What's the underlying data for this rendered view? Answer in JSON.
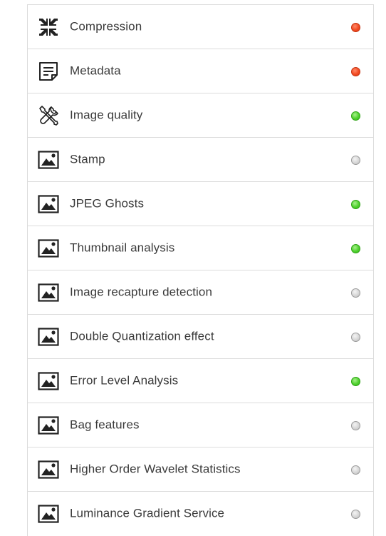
{
  "checks": [
    {
      "label": "Compression",
      "icon": "compress-icon",
      "status": "red",
      "status_color": "#f24a22"
    },
    {
      "label": "Metadata",
      "icon": "document-icon",
      "status": "red",
      "status_color": "#f24a22"
    },
    {
      "label": "Image quality",
      "icon": "tools-icon",
      "status": "green",
      "status_color": "#4fd12e"
    },
    {
      "label": "Stamp",
      "icon": "image-icon",
      "status": "gray",
      "status_color": "#d4d4d4"
    },
    {
      "label": "JPEG Ghosts",
      "icon": "image-icon",
      "status": "green",
      "status_color": "#4fd12e"
    },
    {
      "label": "Thumbnail analysis",
      "icon": "image-icon",
      "status": "green",
      "status_color": "#4fd12e"
    },
    {
      "label": "Image recapture detection",
      "icon": "image-icon",
      "status": "gray",
      "status_color": "#d4d4d4"
    },
    {
      "label": "Double Quantization effect",
      "icon": "image-icon",
      "status": "gray",
      "status_color": "#d4d4d4"
    },
    {
      "label": "Error Level Analysis",
      "icon": "image-icon",
      "status": "green",
      "status_color": "#4fd12e"
    },
    {
      "label": "Bag features",
      "icon": "image-icon",
      "status": "gray",
      "status_color": "#d4d4d4"
    },
    {
      "label": "Higher Order Wavelet Statistics",
      "icon": "image-icon",
      "status": "gray",
      "status_color": "#d4d4d4"
    },
    {
      "label": "Luminance Gradient Service",
      "icon": "image-icon",
      "status": "gray",
      "status_color": "#d4d4d4"
    }
  ]
}
